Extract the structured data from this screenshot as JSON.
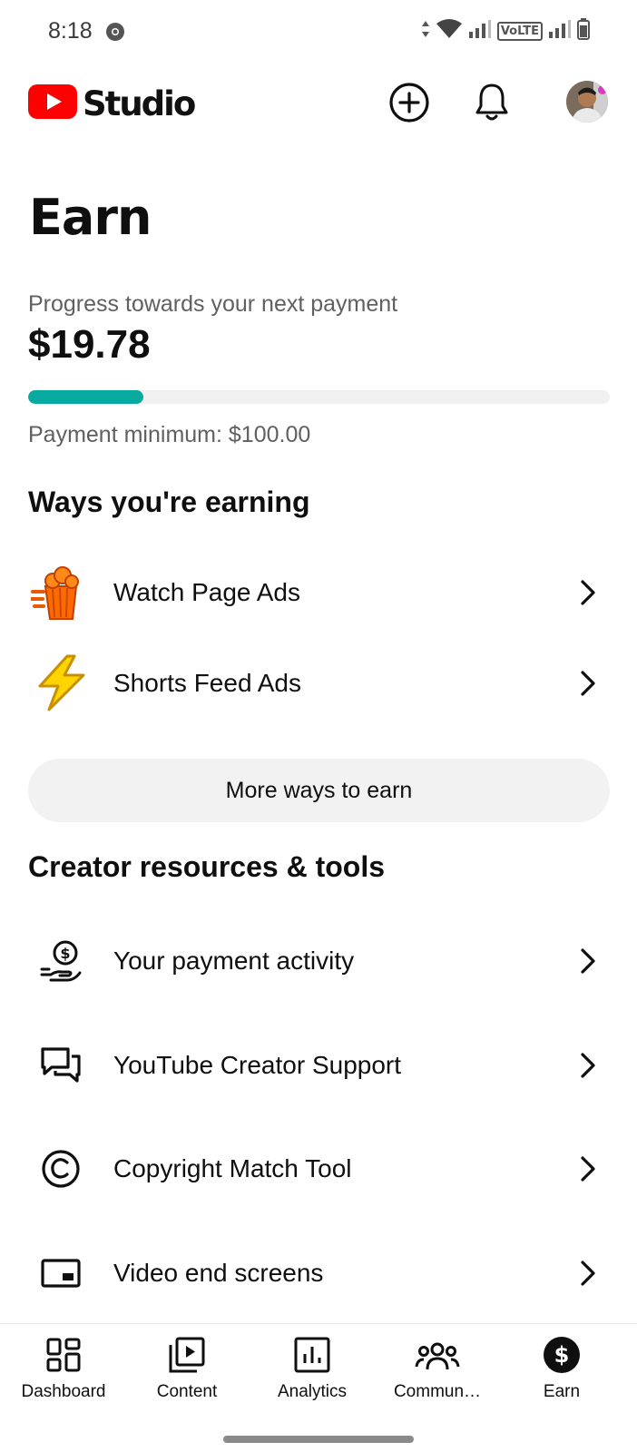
{
  "status_bar": {
    "time": "8:18",
    "network_label": "VoLTE"
  },
  "app": {
    "logo_text": "Studio",
    "brand_color": "#ff0000"
  },
  "page": {
    "title": "Earn",
    "progress_label": "Progress towards your next payment",
    "amount": "$19.78",
    "progress_fraction": 0.1978,
    "progress_color": "#08a99e",
    "minimum": "Payment minimum: $100.00"
  },
  "ways_section": {
    "title": "Ways you're earning",
    "items": [
      {
        "label": "Watch Page Ads",
        "icon": "popcorn-icon"
      },
      {
        "label": "Shorts Feed Ads",
        "icon": "lightning-icon"
      }
    ],
    "more_button": "More ways to earn"
  },
  "resources_section": {
    "title": "Creator resources & tools",
    "items": [
      {
        "label": "Your payment activity",
        "icon": "payment-hand-icon"
      },
      {
        "label": "YouTube Creator Support",
        "icon": "chat-bubbles-icon"
      },
      {
        "label": "Copyright Match Tool",
        "icon": "copyright-icon"
      },
      {
        "label": "Video end screens",
        "icon": "end-screen-icon"
      }
    ]
  },
  "bottom_nav": {
    "items": [
      {
        "label": "Dashboard",
        "icon": "dashboard-icon"
      },
      {
        "label": "Content",
        "icon": "content-icon"
      },
      {
        "label": "Analytics",
        "icon": "analytics-icon"
      },
      {
        "label": "Commun…",
        "icon": "community-icon"
      },
      {
        "label": "Earn",
        "icon": "earn-dollar-icon",
        "selected": true
      }
    ]
  }
}
